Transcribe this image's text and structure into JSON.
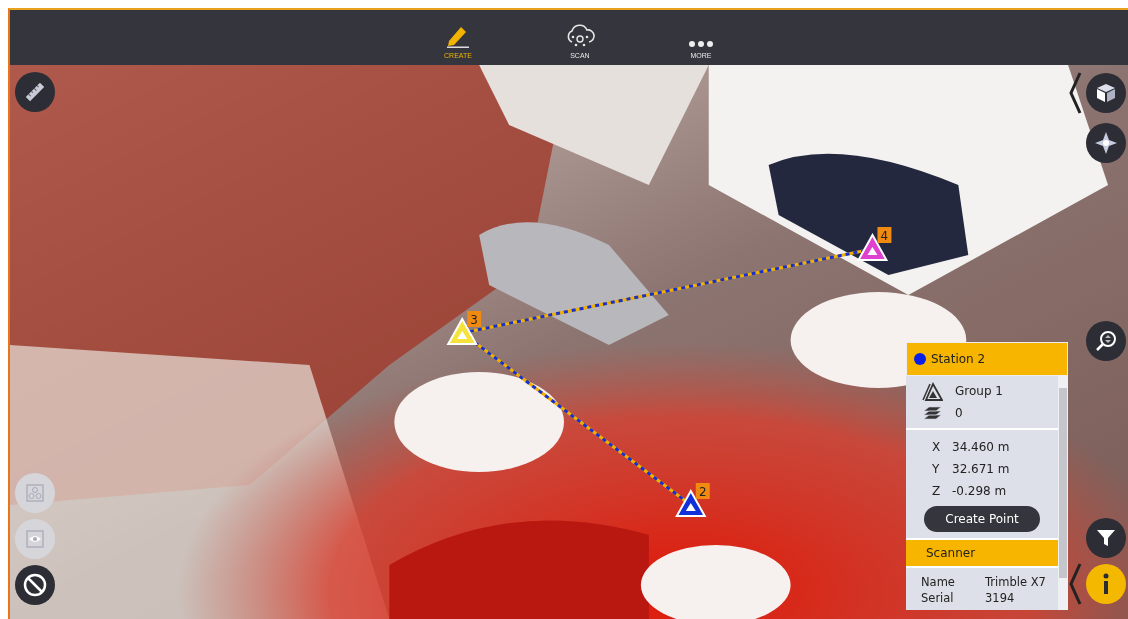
{
  "toolbar": {
    "items": [
      {
        "label": "CREATE",
        "kind": "pencil",
        "selected": true
      },
      {
        "label": "SCAN",
        "kind": "cloud",
        "selected": false
      },
      {
        "label": "MORE",
        "kind": "dots",
        "selected": false
      }
    ]
  },
  "left_tools": [
    {
      "kind": "ruler",
      "disabled": false
    },
    {
      "kind": "group",
      "disabled": true
    },
    {
      "kind": "eye",
      "disabled": true
    },
    {
      "kind": "block",
      "disabled": false
    }
  ],
  "right_tools": [
    {
      "kind": "cube"
    },
    {
      "kind": "compass"
    },
    {
      "kind": "zoom"
    },
    {
      "kind": "filter"
    },
    {
      "kind": "info"
    }
  ],
  "stations": [
    {
      "label": "3",
      "color": "#f5e23a"
    },
    {
      "label": "2",
      "color": "#1230d8"
    },
    {
      "label": "4",
      "color": "#e040d0"
    }
  ],
  "panel": {
    "title": "Station 2",
    "color": "#0b1fe6",
    "group": "Group 1",
    "layers": "0",
    "coords": [
      {
        "axis": "X",
        "value": "34.460 m"
      },
      {
        "axis": "Y",
        "value": "32.671 m"
      },
      {
        "axis": "Z",
        "value": "-0.298 m"
      }
    ],
    "button": "Create Point",
    "section": "Scanner",
    "details": [
      {
        "label": "Name",
        "value": "Trimble X7"
      },
      {
        "label": "Serial",
        "value": "3194"
      }
    ]
  }
}
